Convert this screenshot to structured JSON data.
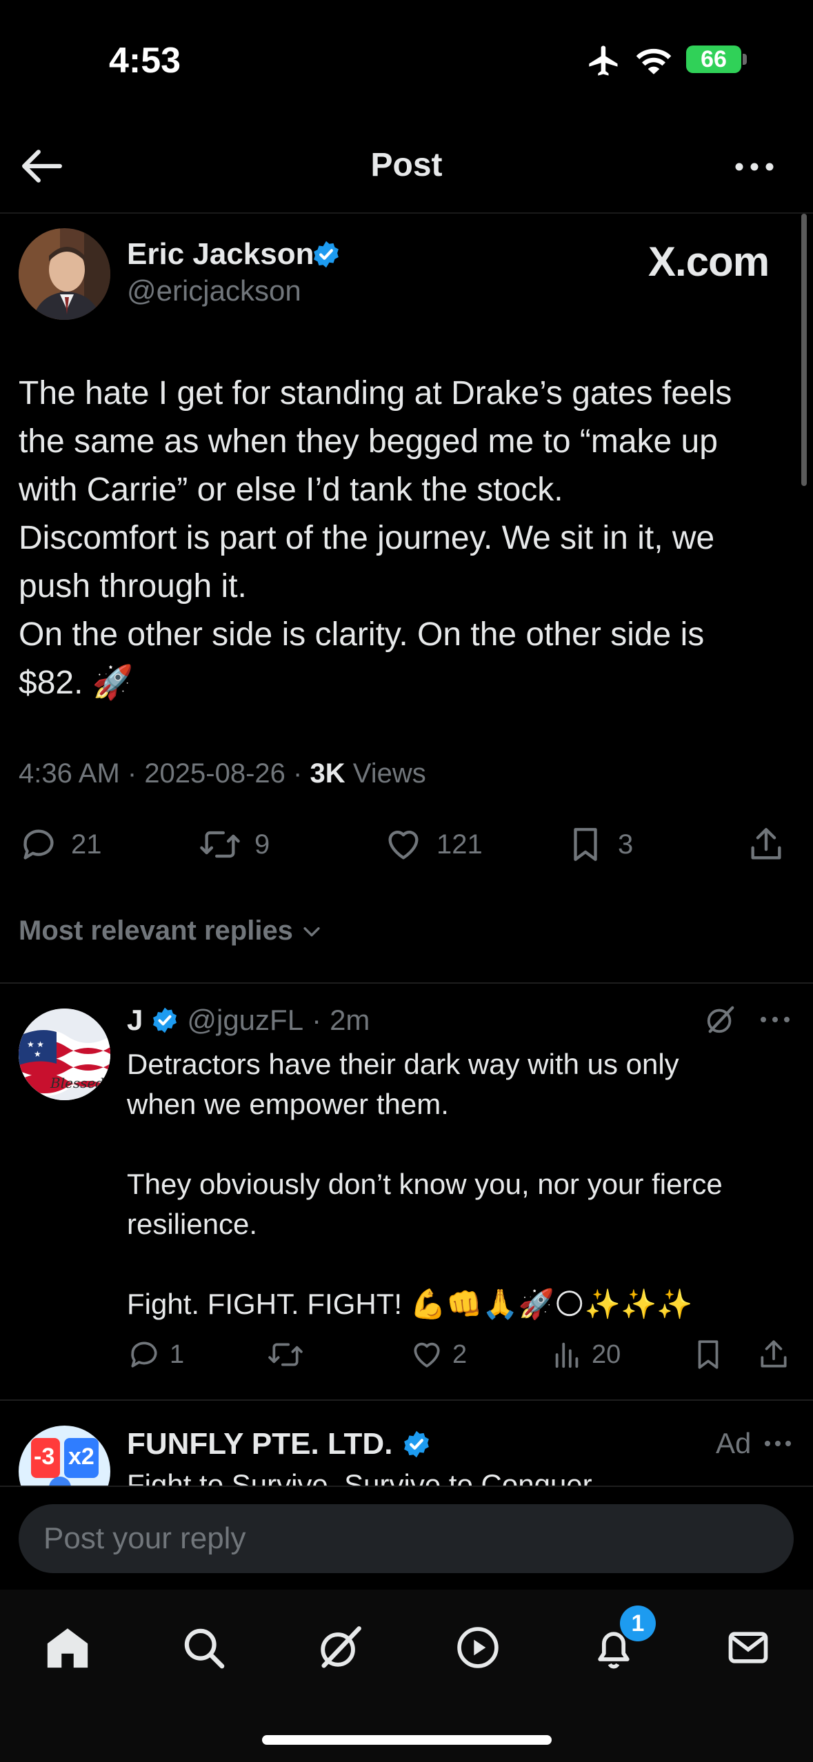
{
  "status_bar": {
    "time": "4:53",
    "battery": "66"
  },
  "header": {
    "title": "Post"
  },
  "post": {
    "author_name": "Eric Jackson",
    "author_handle": "@ericjackson",
    "source_logo": "X.com",
    "text": "The hate I get for standing at Drake’s gates feels\nthe same as when they begged me to “make up\nwith Carrie” or else I’d tank the stock.\nDiscomfort is part of the journey. We sit in it, we\npush through it.\nOn the other side is clarity. On the other side is\n$82. 🚀",
    "time": "4:36 AM",
    "date": "2025-08-26",
    "views_count": "3K",
    "views_label": "Views",
    "replies": "21",
    "reposts": "9",
    "likes": "121",
    "bookmarks": "3"
  },
  "replies_filter": {
    "label": "Most relevant replies"
  },
  "reply": {
    "name": "J",
    "handle": "@jguzFL",
    "age": "2m",
    "text": "Detractors have their dark way with us only\nwhen we empower them.\n\nThey obviously don’t know you, nor your fierce\nresilience.\n\nFight. FIGHT. FIGHT! 💪👊🙏🚀🌕✨✨✨",
    "replies": "1",
    "reposts": "",
    "likes": "2",
    "views": "20",
    "avatar_text": "Blessed"
  },
  "ad": {
    "name": "FUNFLY PTE. LTD.",
    "label": "Ad",
    "text": "Fight to Survive, Survive to Conquer",
    "avatar_texts": [
      "-3",
      "x2"
    ]
  },
  "composer": {
    "placeholder": "Post your reply"
  },
  "tabbar": {
    "items": [
      "home-icon",
      "search-icon",
      "grok-icon",
      "video-icon",
      "notifications-icon",
      "messages-icon"
    ],
    "notifications_badge": "1"
  },
  "colors": {
    "accent": "#1d9bf0",
    "verified": "#1d9bf0",
    "muted": "#71767b",
    "background": "#000000"
  }
}
